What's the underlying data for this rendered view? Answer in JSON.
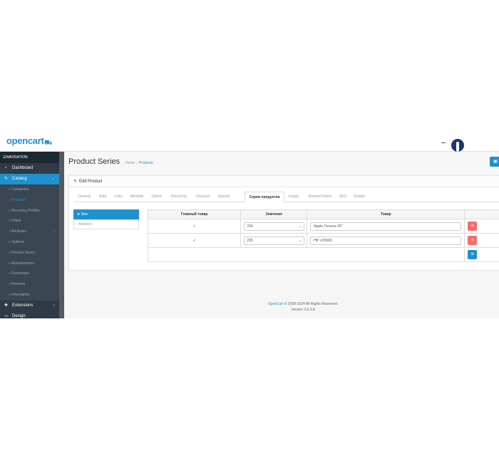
{
  "header": {
    "logo_text": "opencart",
    "logo_cart": "⛟"
  },
  "sidebar": {
    "heading": "NAVIGATION",
    "items": [
      {
        "label": "Dashboard",
        "icon": "dashboard-icon"
      },
      {
        "label": "Catalog",
        "icon": "tag-icon",
        "active": true
      },
      {
        "label": "Extensions",
        "icon": "puzzle-icon"
      },
      {
        "label": "Design",
        "icon": "monitor-icon"
      }
    ],
    "catalog_sub": [
      {
        "label": "Categories"
      },
      {
        "label": "Products",
        "active": true
      },
      {
        "label": "Recurring Profiles"
      },
      {
        "label": "Filters"
      },
      {
        "label": "Attributes",
        "has_children": true
      },
      {
        "label": "Options"
      },
      {
        "label": "Product Series"
      },
      {
        "label": "Manufacturers"
      },
      {
        "label": "Downloads"
      },
      {
        "label": "Reviews"
      },
      {
        "label": "Information"
      }
    ]
  },
  "page": {
    "title": "Product Series",
    "breadcrumb": [
      "Home",
      "Products"
    ]
  },
  "panel": {
    "heading": "Edit Product",
    "tabs": [
      "General",
      "Data",
      "Links",
      "Attribute",
      "Option",
      "Recurring",
      "Discount",
      "Special",
      "Серии продуктов",
      "Image",
      "Reward Points",
      "SEO",
      "Design"
    ],
    "active_tab": "Серии продуктов"
  },
  "vertical_tabs": [
    {
      "label": "Size",
      "active": true
    },
    {
      "label": "Variation"
    }
  ],
  "table": {
    "headers": [
      "Главный товар",
      "Значение",
      "Товар"
    ],
    "rows": [
      {
        "main": "✓",
        "value": "224",
        "product": "Apple Cinema 30\""
      },
      {
        "main": "✓",
        "value": "235",
        "product": "HP LP3065"
      }
    ]
  },
  "footer": {
    "brand": "OpenCart",
    "copyright": "© 2009-2024 All Rights Reserved.",
    "version": "Version 3.0.3.8"
  },
  "colors": {
    "accent": "#1e91cf",
    "danger": "#f56b6b",
    "sidebar": "#2e3a45"
  }
}
